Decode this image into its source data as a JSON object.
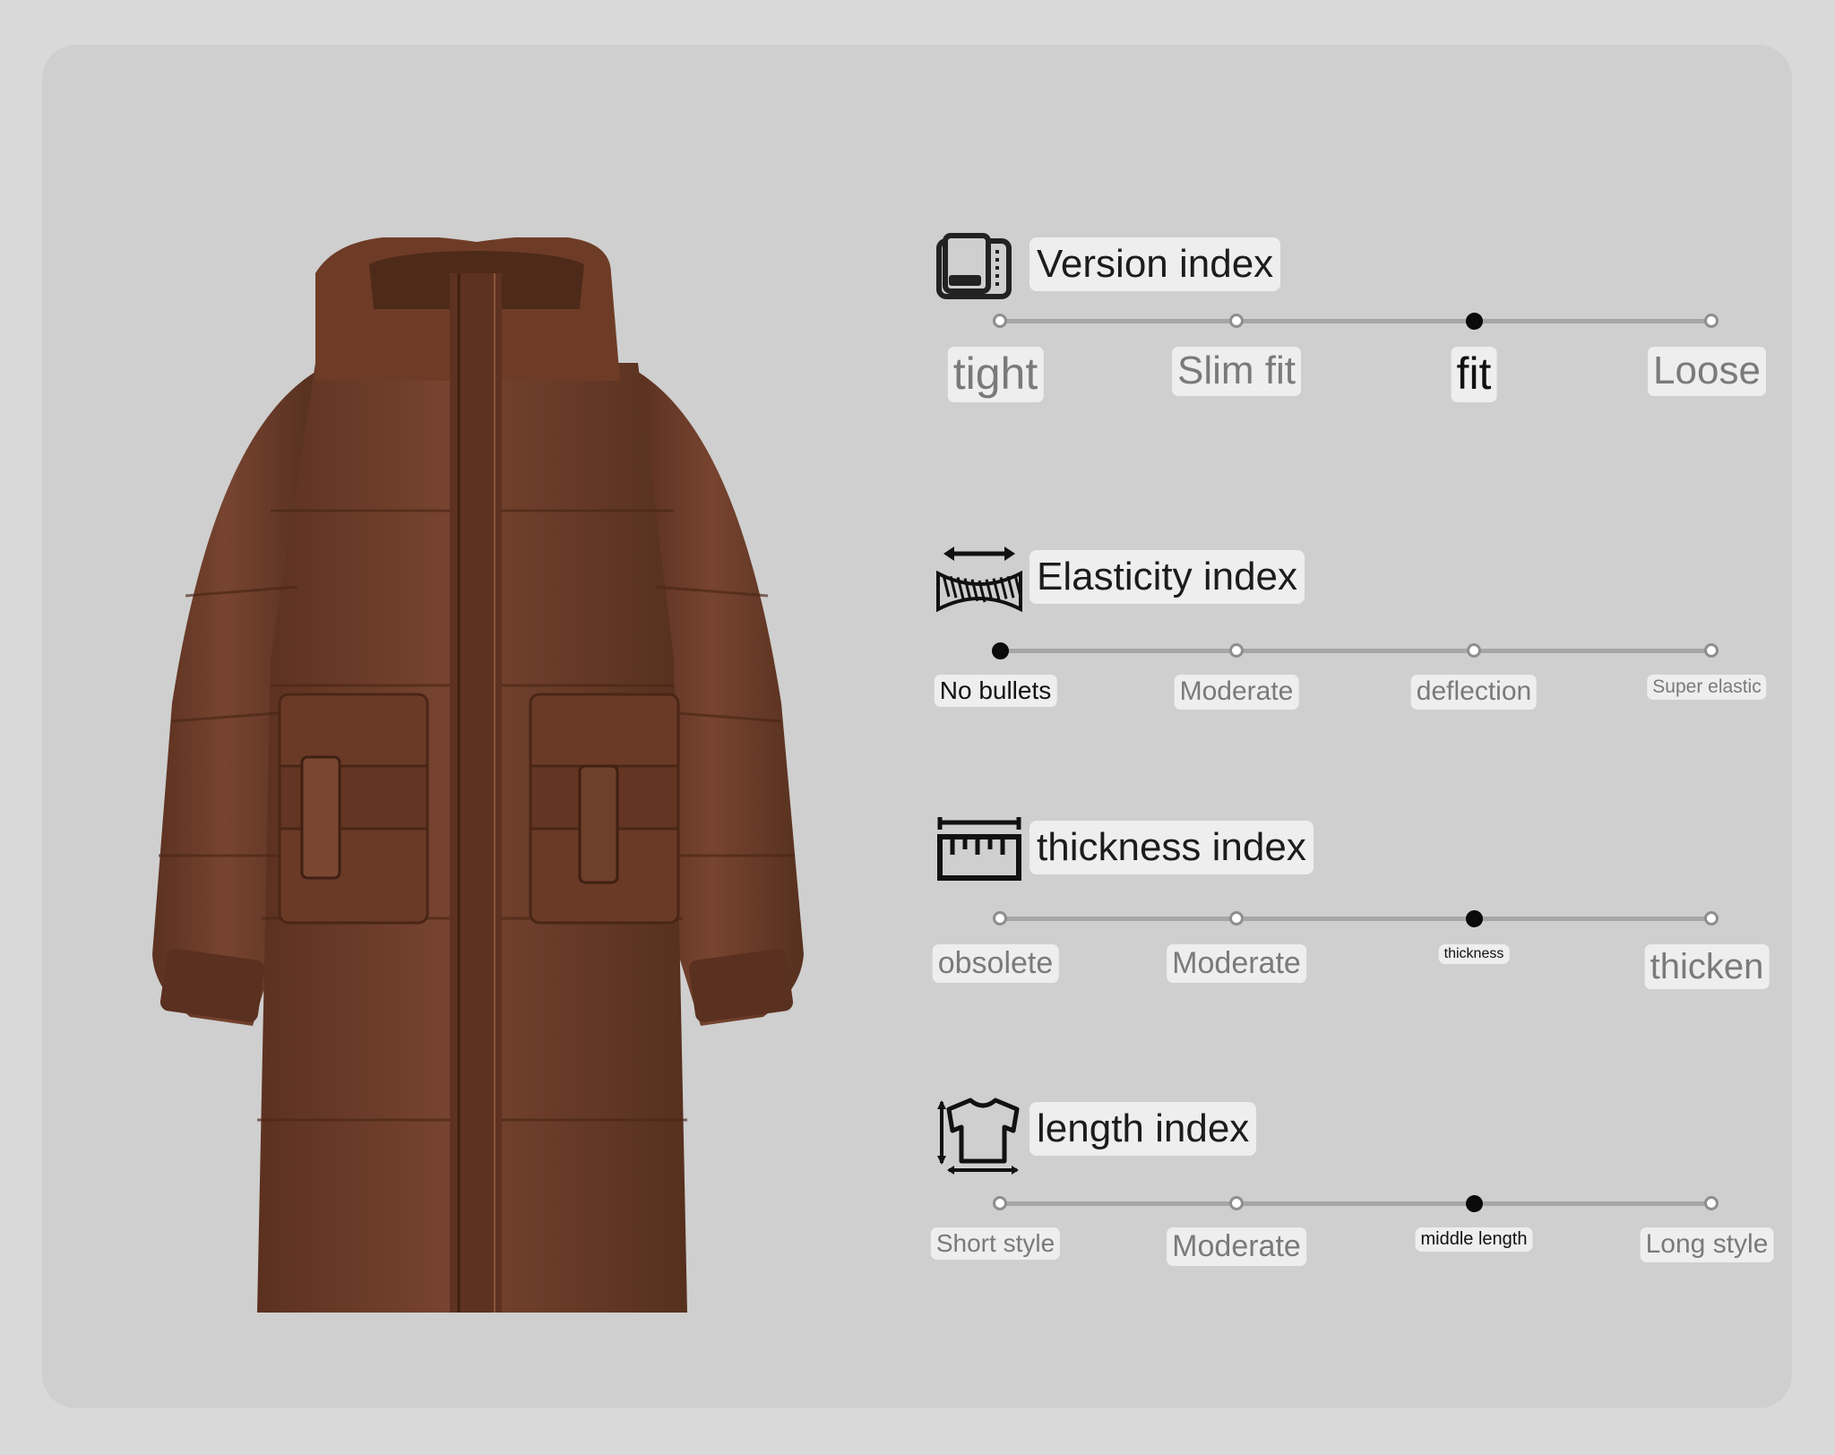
{
  "indices": [
    {
      "key": "version",
      "title": "Version index",
      "icon": "fabric-book-icon",
      "options": [
        "tight",
        "Slim fit",
        "fit",
        "Loose"
      ],
      "selected_index": 2
    },
    {
      "key": "elasticity",
      "title": "Elasticity index",
      "icon": "stretch-fabric-icon",
      "options": [
        "No bullets",
        "Moderate",
        "deflection",
        "Super elastic"
      ],
      "selected_index": 0
    },
    {
      "key": "thickness",
      "title": "thickness index",
      "icon": "ruler-icon",
      "options": [
        "obsolete",
        "Moderate",
        "thickness",
        "thicken"
      ],
      "selected_index": 2
    },
    {
      "key": "length",
      "title": "length index",
      "icon": "shirt-length-icon",
      "options": [
        "Short style",
        "Moderate",
        "middle length",
        "Long style"
      ],
      "selected_index": 2
    }
  ],
  "colors": {
    "background": "#d9d9d9",
    "card": "#cfcfcf",
    "coat": "#6b3a22",
    "selected_dot": "#0b0b0b"
  }
}
